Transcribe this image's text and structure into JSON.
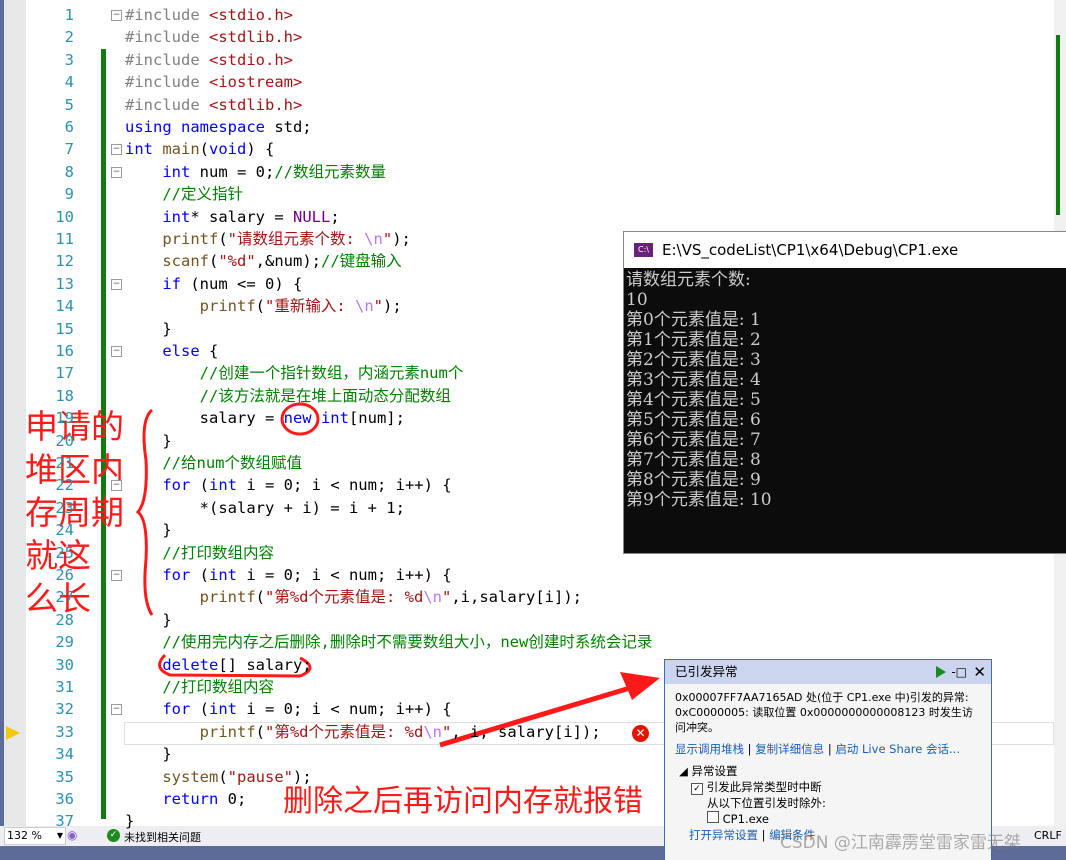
{
  "editor": {
    "lines": [
      [
        [
          "p",
          "#include "
        ],
        [
          "s",
          "<stdio.h>"
        ]
      ],
      [
        [
          "p",
          "#include "
        ],
        [
          "s",
          "<stdlib.h>"
        ]
      ],
      [
        [
          "p",
          "#include "
        ],
        [
          "s",
          "<stdio.h>"
        ]
      ],
      [
        [
          "p",
          "#include "
        ],
        [
          "s",
          "<iostream>"
        ]
      ],
      [
        [
          "p",
          "#include "
        ],
        [
          "s",
          "<stdlib.h>"
        ]
      ],
      [
        [
          "k",
          "using namespace "
        ],
        [
          "n",
          "std;"
        ]
      ],
      [
        [
          "k",
          "int "
        ],
        [
          "f",
          "main"
        ],
        [
          "n",
          "("
        ],
        [
          "k",
          "void"
        ],
        [
          "n",
          ") {"
        ]
      ],
      [
        [
          "n",
          "    "
        ],
        [
          "k",
          "int "
        ],
        [
          "n",
          "num = 0;"
        ],
        [
          "c",
          "//数组元素数量"
        ]
      ],
      [
        [
          "n",
          "    "
        ],
        [
          "c",
          "//定义指针"
        ]
      ],
      [
        [
          "n",
          "    "
        ],
        [
          "k",
          "int"
        ],
        [
          "n",
          "* salary = "
        ],
        [
          "m",
          "NULL"
        ],
        [
          "n",
          ";"
        ]
      ],
      [
        [
          "n",
          "    "
        ],
        [
          "f",
          "printf"
        ],
        [
          "n",
          "("
        ],
        [
          "s",
          "\"请数组元素个数: "
        ],
        [
          "e",
          "\\n"
        ],
        [
          "s",
          "\""
        ],
        [
          "n",
          ");"
        ]
      ],
      [
        [
          "n",
          "    "
        ],
        [
          "f",
          "scanf"
        ],
        [
          "n",
          "("
        ],
        [
          "s",
          "\"%d\""
        ],
        [
          "n",
          ",&num);"
        ],
        [
          "c",
          "//键盘输入"
        ]
      ],
      [
        [
          "n",
          "    "
        ],
        [
          "k",
          "if "
        ],
        [
          "n",
          "(num <= 0) {"
        ]
      ],
      [
        [
          "n",
          "        "
        ],
        [
          "f",
          "printf"
        ],
        [
          "n",
          "("
        ],
        [
          "s",
          "\"重新输入: "
        ],
        [
          "e",
          "\\n"
        ],
        [
          "s",
          "\""
        ],
        [
          "n",
          ");"
        ]
      ],
      [
        [
          "n",
          "    }"
        ]
      ],
      [
        [
          "n",
          "    "
        ],
        [
          "k",
          "else "
        ],
        [
          "n",
          "{"
        ]
      ],
      [
        [
          "n",
          "        "
        ],
        [
          "c",
          "//创建一个指针数组，内涵元素num个"
        ]
      ],
      [
        [
          "n",
          "        "
        ],
        [
          "c",
          "//该方法就是在堆上面动态分配数组"
        ]
      ],
      [
        [
          "n",
          "        salary = "
        ],
        [
          "k",
          "new int"
        ],
        [
          "n",
          "[num];"
        ]
      ],
      [
        [
          "n",
          "    }"
        ]
      ],
      [
        [
          "n",
          "    "
        ],
        [
          "c",
          "//给num个数组赋值"
        ]
      ],
      [
        [
          "n",
          "    "
        ],
        [
          "k",
          "for "
        ],
        [
          "n",
          "("
        ],
        [
          "k",
          "int "
        ],
        [
          "n",
          "i = 0; i < num; i++) {"
        ]
      ],
      [
        [
          "n",
          "        *(salary + i) = i + 1;"
        ]
      ],
      [
        [
          "n",
          "    }"
        ]
      ],
      [
        [
          "n",
          "    "
        ],
        [
          "c",
          "//打印数组内容"
        ]
      ],
      [
        [
          "n",
          "    "
        ],
        [
          "k",
          "for "
        ],
        [
          "n",
          "("
        ],
        [
          "k",
          "int "
        ],
        [
          "n",
          "i = 0; i < num; i++) {"
        ]
      ],
      [
        [
          "n",
          "        "
        ],
        [
          "f",
          "printf"
        ],
        [
          "n",
          "("
        ],
        [
          "s",
          "\"第%d个元素值是: %d"
        ],
        [
          "e",
          "\\n"
        ],
        [
          "s",
          "\""
        ],
        [
          "n",
          ",i,salary[i]);"
        ]
      ],
      [
        [
          "n",
          "    }"
        ]
      ],
      [
        [
          "n",
          "    "
        ],
        [
          "c",
          "//使用完内存之后删除,删除时不需要数组大小，new创建时系统会记录"
        ]
      ],
      [
        [
          "n",
          "    "
        ],
        [
          "k",
          "delete"
        ],
        [
          "n",
          "[] salary;"
        ]
      ],
      [
        [
          "n",
          "    "
        ],
        [
          "c",
          "//打印数组内容"
        ]
      ],
      [
        [
          "n",
          "    "
        ],
        [
          "k",
          "for "
        ],
        [
          "n",
          "("
        ],
        [
          "k",
          "int "
        ],
        [
          "n",
          "i = 0; i < num; i++) {"
        ]
      ],
      [
        [
          "n",
          "        "
        ],
        [
          "f",
          "printf"
        ],
        [
          "n",
          "("
        ],
        [
          "s",
          "\"第%d个元素值是: %d"
        ],
        [
          "e",
          "\\n"
        ],
        [
          "s",
          "\""
        ],
        [
          "n",
          ", i, salary[i]);"
        ]
      ],
      [
        [
          "n",
          "    }"
        ]
      ],
      [
        [
          "n",
          "    "
        ],
        [
          "f",
          "system"
        ],
        [
          "n",
          "("
        ],
        [
          "s",
          "\"pause\""
        ],
        [
          "n",
          ");"
        ]
      ],
      [
        [
          "n",
          "    "
        ],
        [
          "k",
          "return "
        ],
        [
          "n",
          "0;"
        ]
      ],
      [
        [
          "n",
          "}"
        ]
      ]
    ],
    "fold_lines": [
      1,
      7,
      8,
      13,
      16,
      22,
      26,
      32
    ],
    "current_line": 33
  },
  "console": {
    "title": "E:\\VS_codeList\\CP1\\x64\\Debug\\CP1.exe",
    "icon_label": "C:\\",
    "output": [
      "请数组元素个数:",
      "10",
      "第0个元素值是: 1",
      "第1个元素值是: 2",
      "第2个元素值是: 3",
      "第3个元素值是: 4",
      "第4个元素值是: 5",
      "第5个元素值是: 6",
      "第6个元素值是: 7",
      "第7个元素值是: 8",
      "第8个元素值是: 9",
      "第9个元素值是: 10"
    ]
  },
  "exception": {
    "title": "已引发异常",
    "message": "0x00007FF7AA7165AD 处(位于 CP1.exe 中)引发的异常: 0xC0000005: 读取位置 0x0000000000008123 时发生访问冲突。",
    "links": [
      "显示调用堆栈",
      "复制详细信息",
      "启动 Live Share 会话..."
    ],
    "settings_label": "异常设置",
    "break_label": "引发此异常类型时中断",
    "break_checked": true,
    "except_label": "从以下位置引发时除外:",
    "cp1_label": "CP1.exe",
    "cp1_checked": false,
    "bottom_links": [
      "打开异常设置",
      "编辑条件"
    ]
  },
  "status": {
    "zoom": "132 %",
    "issues": "未找到相关问题",
    "line_ending": "CRLF"
  },
  "annotations": {
    "side_note": [
      "申请的",
      "堆区内",
      "存周期",
      "就这",
      "么长"
    ],
    "bottom_note": "删除之后再访问内存就报错"
  },
  "watermark": "CSDN @江南霹雳堂雷家雷无桀"
}
